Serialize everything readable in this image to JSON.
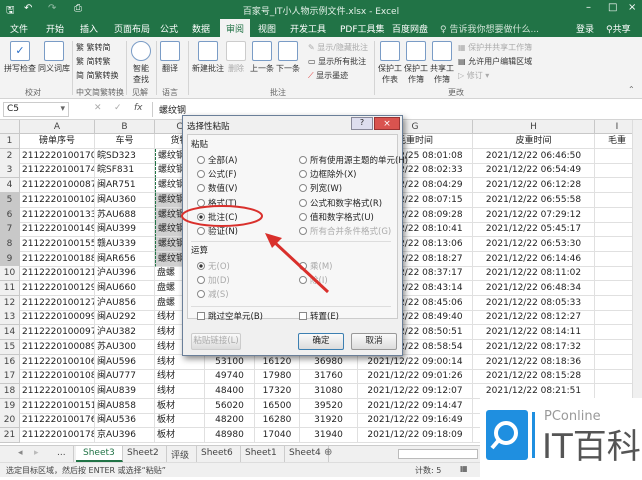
{
  "window": {
    "title": "百家号_IT小人物示例文件.xlsx - Excel"
  },
  "tabs": [
    "文件",
    "开始",
    "插入",
    "页面布局",
    "公式",
    "数据",
    "审阅",
    "视图",
    "开发工具",
    "PDF工具集",
    "百度网盘"
  ],
  "tell_me": "告诉我你想要做什么...",
  "login": "登录",
  "share": "共享",
  "ribbon": {
    "proof": {
      "spell": "拼写检查",
      "thesaurus": "同义词库",
      "group": "校对"
    },
    "chinese": {
      "t2s": "繁转简",
      "s2t": "简转繁",
      "convert": "简繁转换",
      "group": "中文简繁转换"
    },
    "insights": {
      "smart": "智能查找",
      "group": "见解"
    },
    "language": {
      "translate": "翻译",
      "group": "语言"
    },
    "comments": {
      "new": "新建批注",
      "delete": "删除",
      "prev": "上一条",
      "next": "下一条",
      "showhide": "显示/隐藏批注",
      "showall": "显示所有批注",
      "ink": "显示墨迹",
      "group": "批注"
    },
    "changes": {
      "protect_sheet": "保护工作表",
      "protect_book": "保护工作簿",
      "share_book": "共享工作簿",
      "protect_share": "保护并共享工作簿",
      "allow_edit": "允许用户编辑区域",
      "track": "修订",
      "group": "更改"
    }
  },
  "formula": {
    "namebox": "C5",
    "fx": "fx",
    "value": "螺纹钢"
  },
  "columns": [
    "A",
    "B",
    "C",
    "D",
    "E",
    "F",
    "G",
    "H",
    "I"
  ],
  "headers": [
    "磅单序号",
    "车号",
    "货物",
    "",
    "",
    "",
    "毛重时间",
    "皮重时间",
    "毛重"
  ],
  "rows": [
    [
      "2112220100170",
      "皖SD323",
      "螺纹钢",
      "",
      "",
      "",
      "2021/12/25 08:01:08",
      "2021/12/22 06:46:50"
    ],
    [
      "2112220100174",
      "皖SF831",
      "螺纹钢",
      "",
      "",
      "",
      "2021/12/22 08:02:33",
      "2021/12/22 06:54:49"
    ],
    [
      "2112220100087",
      "闽AR751",
      "螺纹钢",
      "",
      "",
      "",
      "2021/12/22 08:04:29",
      "2021/12/22 06:12:28"
    ],
    [
      "2112220100102",
      "闽AU360",
      "螺纹钢",
      "",
      "",
      "",
      "2021/12/22 08:07:15",
      "2021/12/22 06:55:58"
    ],
    [
      "2112220100133",
      "苏AU688",
      "螺纹钢",
      "",
      "",
      "",
      "2021/12/22 08:09:28",
      "2021/12/22 07:29:12"
    ],
    [
      "2112220100149",
      "闽AU399",
      "螺纹钢",
      "",
      "",
      "",
      "2021/12/22 08:10:41",
      "2021/12/22 05:45:17"
    ],
    [
      "2112220100155",
      "赣AU339",
      "螺纹钢",
      "",
      "",
      "",
      "2021/12/22 08:13:06",
      "2021/12/22 06:53:30"
    ],
    [
      "2112220100188",
      "闽AR656",
      "螺纹钢",
      "",
      "",
      "",
      "2021/12/22 08:18:27",
      "2021/12/22 06:14:46"
    ],
    [
      "2112220100121",
      "沪AU396",
      "盘螺",
      "",
      "",
      "",
      "2021/12/22 08:37:17",
      "2021/12/22 08:11:02"
    ],
    [
      "2112220100129",
      "闽AU660",
      "盘螺",
      "",
      "",
      "",
      "2021/12/22 08:43:14",
      "2021/12/22 06:48:34"
    ],
    [
      "2112220100127",
      "沪AU856",
      "盘螺",
      "",
      "",
      "",
      "2021/12/22 08:45:06",
      "2021/12/22 08:05:33"
    ],
    [
      "2112220100099",
      "闽AU292",
      "线材",
      "",
      "",
      "",
      "2021/12/22 08:49:40",
      "2021/12/22 08:12:27"
    ],
    [
      "2112220100097",
      "沪AU382",
      "线材",
      "",
      "",
      "",
      "2021/12/22 08:50:51",
      "2021/12/22 08:14:11"
    ],
    [
      "2112220100089",
      "苏AU300",
      "线材",
      "",
      "",
      "",
      "2021/12/22 08:58:54",
      "2021/12/22 08:17:32"
    ],
    [
      "2112220100106",
      "闽AU596",
      "线材",
      "53100",
      "16120",
      "36980",
      "2021/12/22 09:00:14",
      "2021/12/22 08:18:36"
    ],
    [
      "2112220100108",
      "闽AU777",
      "线材",
      "49740",
      "17980",
      "31760",
      "2021/12/22 09:01:26",
      "2021/12/22 08:15:28"
    ],
    [
      "2112220100109",
      "闽AU839",
      "线材",
      "48400",
      "17320",
      "31080",
      "2021/12/22 09:12:07",
      "2021/12/22 08:21:51"
    ],
    [
      "2112220100151",
      "闽AU858",
      "板材",
      "56020",
      "16500",
      "39520",
      "2021/12/22 09:14:47",
      ""
    ],
    [
      "2112220100176",
      "闽AU536",
      "板材",
      "48200",
      "16280",
      "31920",
      "2021/12/22 09:16:49",
      ""
    ],
    [
      "2112220100178",
      "京AU396",
      "板材",
      "48980",
      "17040",
      "31940",
      "2021/12/22 09:18:09",
      ""
    ]
  ],
  "sheets": [
    "...",
    "Sheet3",
    "Sheet2",
    "评级",
    "Sheet6",
    "Sheet1",
    "Sheet4"
  ],
  "status": {
    "msg": "选定目标区域，然后按 ENTER 或选择“粘贴”",
    "count": "计数: 5"
  },
  "dialog": {
    "title": "选择性粘贴",
    "paste_label": "粘贴",
    "paste_left": [
      "全部(A)",
      "公式(F)",
      "数值(V)",
      "格式(T)",
      "批注(C)",
      "验证(N)"
    ],
    "paste_right": [
      "所有使用源主题的单元(H)",
      "边框除外(X)",
      "列宽(W)",
      "公式和数字格式(R)",
      "值和数字格式(U)",
      "所有合并条件格式(G)"
    ],
    "op_label": "运算",
    "op_left": [
      "无(O)",
      "加(D)",
      "减(S)"
    ],
    "op_right": [
      "乘(M)",
      "除(I)"
    ],
    "skip_blanks": "跳过空单元(B)",
    "transpose": "转置(E)",
    "paste_link": "粘贴链接(L)",
    "ok": "确定",
    "cancel": "取消",
    "help": "?",
    "close": "×"
  },
  "watermark": {
    "brand": "PConline",
    "name": "IT百科"
  },
  "colors": {
    "excel_green": "#217346",
    "annotation_red": "#d9302c",
    "logo_blue": "#1f8fe0"
  }
}
